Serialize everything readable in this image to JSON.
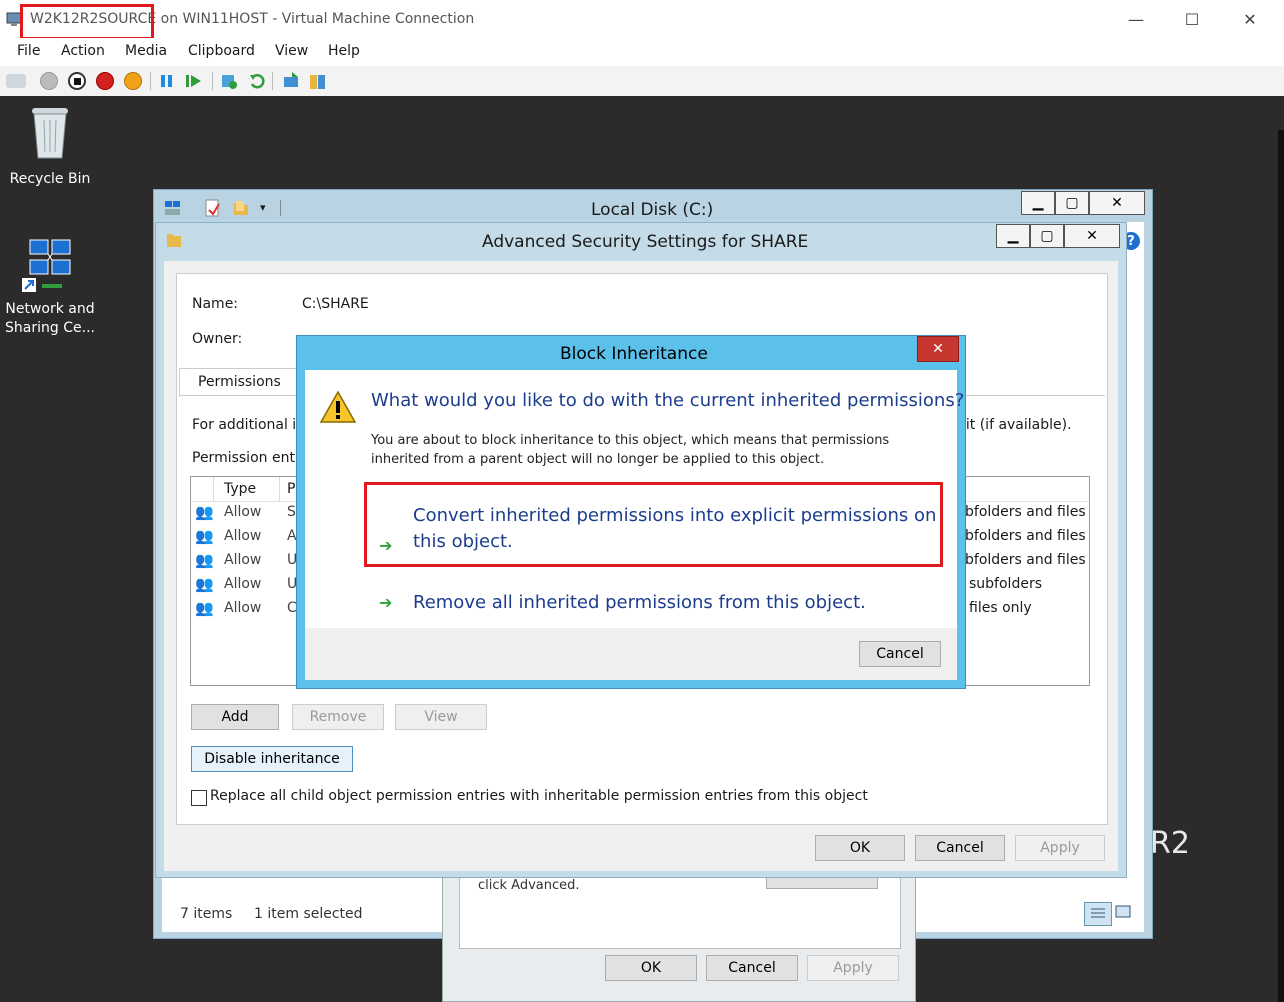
{
  "window": {
    "title": "W2K12R2SOURCE on WIN11HOST - Virtual Machine Connection",
    "controls": {
      "minimize": "—",
      "maximize": "☐",
      "close": "✕"
    }
  },
  "menu": [
    "File",
    "Action",
    "Media",
    "Clipboard",
    "View",
    "Help"
  ],
  "toolbar_icons": [
    "ctrl-alt-del-icon",
    "start-icon",
    "turn-off-icon",
    "shutdown-icon",
    "power-icon",
    "pause-icon",
    "resume-icon",
    "checkpoint-icon",
    "revert-icon",
    "enhanced-session-icon",
    "share-icon"
  ],
  "desktop": {
    "icons": [
      {
        "label": "Recycle Bin",
        "icon": "recycle-bin-icon"
      },
      {
        "label": "Network and Sharing Ce...",
        "icon": "network-icon"
      }
    ],
    "watermark": "R2"
  },
  "explorer": {
    "title": "Local Disk (C:)",
    "status_items": "7 items",
    "status_selected": "1 item selected"
  },
  "props": {
    "text": "click Advanced.",
    "ok": "OK",
    "cancel": "Cancel",
    "apply": "Apply"
  },
  "advanced": {
    "title": "Advanced Security Settings for SHARE",
    "name_label": "Name:",
    "name_value": "C:\\SHARE",
    "owner_label": "Owner:",
    "tab_permissions": "Permissions",
    "info_left": "For additional in",
    "info_right": "dit (if available).",
    "entries_label": "Permission entri",
    "col_type": "Type",
    "col_principal": "P",
    "rows": [
      {
        "type": "Allow",
        "p": "S",
        "applies": "bfolders and files"
      },
      {
        "type": "Allow",
        "p": "A",
        "applies": "bfolders and files"
      },
      {
        "type": "Allow",
        "p": "U",
        "applies": "bfolders and files"
      },
      {
        "type": "Allow",
        "p": "U",
        "applies": "subfolders"
      },
      {
        "type": "Allow",
        "p": "C",
        "applies": "files only"
      }
    ],
    "add": "Add",
    "remove": "Remove",
    "view": "View",
    "disable_inheritance": "Disable inheritance",
    "replace_checkbox": "Replace all child object permission entries with inheritable permission entries from this object",
    "ok": "OK",
    "cancel": "Cancel",
    "apply": "Apply"
  },
  "block": {
    "title": "Block Inheritance",
    "close": "✕",
    "question": "What would you like to do with the current inherited permissions?",
    "description_line1": "You are about to block inheritance to this object, which means that permissions",
    "description_line2": "inherited from a parent object will no longer be applied to this object.",
    "option1_line1": "Convert inherited permissions into explicit permissions on",
    "option1_line2": "this object.",
    "option2": "Remove all inherited permissions from this object.",
    "cancel": "Cancel"
  },
  "colors": {
    "highlight": "#e0191e",
    "dialog_frame": "#5bc0ea",
    "link": "#1c3d8c"
  }
}
